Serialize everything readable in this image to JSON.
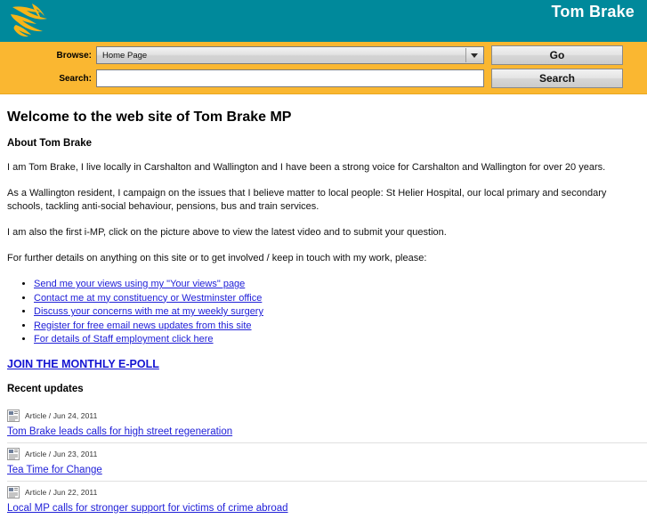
{
  "header": {
    "site_title": "Tom Brake",
    "logo_icon": "libdem-bird-logo",
    "bg_color": "#00899b"
  },
  "nav": {
    "bg_color": "#fab731",
    "browse_label": "Browse:",
    "browse_value": "Home Page",
    "browse_options": [
      "Home Page"
    ],
    "go_label": "Go",
    "search_label": "Search:",
    "search_value": "",
    "search_placeholder": "",
    "search_button_label": "Search"
  },
  "main": {
    "page_title": "Welcome to the web site of Tom Brake MP",
    "about_heading": "About Tom Brake",
    "paragraphs": [
      "I am Tom Brake, I live locally in Carshalton and Wallington and I have been a strong voice for Carshalton and Wallington for over 20 years.",
      "As a Wallington resident, I campaign on the issues that I believe matter to local people: St Helier Hospital, our local primary and secondary schools, tackling anti-social behaviour, pensions, bus and train services.",
      "I am also the first i-MP, click on the picture above to view the latest video and to submit your question.",
      "For further details on anything on this site or to get involved / keep in touch with my work, please:"
    ],
    "links": [
      "Send me your views using my \"Your views\" page",
      "Contact me at my constituency or Westminster office",
      "Discuss your concerns with me at my weekly surgery",
      "Register for free email news updates from this site",
      "For details of Staff employment click here"
    ],
    "epoll_link": "JOIN THE MONTHLY E-POLL",
    "updates_heading": "Recent updates",
    "updates": [
      {
        "icon": "article-icon",
        "meta": "Article / Jun 24, 2011",
        "title": "Tom Brake leads calls for high street regeneration"
      },
      {
        "icon": "article-icon",
        "meta": "Article / Jun 23, 2011",
        "title": "Tea Time for Change"
      },
      {
        "icon": "article-icon",
        "meta": "Article / Jun 22, 2011",
        "title": "Local MP calls for stronger support for victims of crime abroad"
      }
    ]
  },
  "colors": {
    "teal": "#00899b",
    "gold": "#fab731",
    "link_blue": "#2020d8"
  }
}
